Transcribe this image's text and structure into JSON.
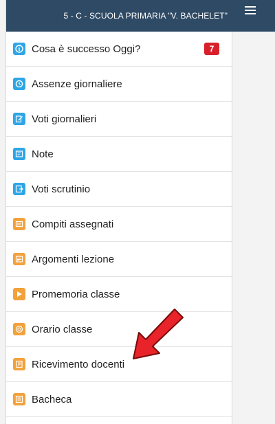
{
  "header": {
    "title": "5 - C - SCUOLA PRIMARIA \"V. BACHELET\""
  },
  "menu": {
    "items": [
      {
        "label": "Cosa è successo Oggi?",
        "icon": "info-icon",
        "color": "#2ea6e6",
        "badge": "7"
      },
      {
        "label": "Assenze giornaliere",
        "icon": "absence-icon",
        "color": "#2ea6e6"
      },
      {
        "label": "Voti giornalieri",
        "icon": "grades-icon",
        "color": "#2ea6e6"
      },
      {
        "label": "Note",
        "icon": "notes-icon",
        "color": "#2ea6e6"
      },
      {
        "label": "Voti scrutinio",
        "icon": "scrutiny-icon",
        "color": "#2ea6e6"
      },
      {
        "label": "Compiti assegnati",
        "icon": "homework-icon",
        "color": "#f2a13b"
      },
      {
        "label": "Argomenti lezione",
        "icon": "lesson-topics-icon",
        "color": "#f2a13b"
      },
      {
        "label": "Promemoria classe",
        "icon": "reminder-icon",
        "color": "#f2a13b"
      },
      {
        "label": "Orario classe",
        "icon": "timetable-icon",
        "color": "#f2a13b"
      },
      {
        "label": "Ricevimento docenti",
        "icon": "teacher-meeting-icon",
        "color": "#f2a13b"
      },
      {
        "label": "Bacheca",
        "icon": "noticeboard-icon",
        "color": "#f2a13b"
      }
    ]
  },
  "colors": {
    "header_bg": "#2f4a64",
    "badge_bg": "#d9202a",
    "arrow": "#e8232a"
  }
}
